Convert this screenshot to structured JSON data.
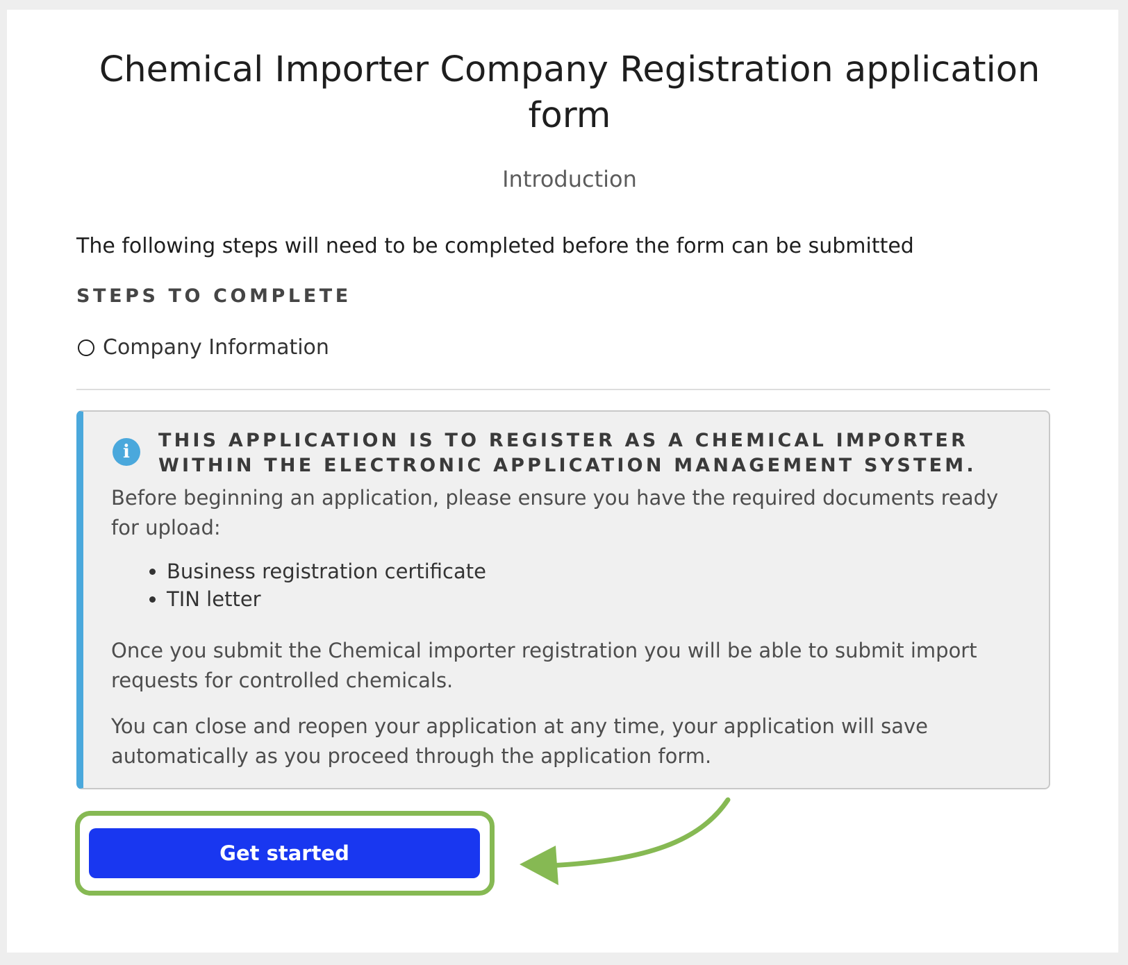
{
  "form": {
    "title": "Chemical Importer Company Registration application form",
    "subtitle": "Introduction",
    "lead": "The following steps will need to be completed before the form can be submitted",
    "steps_heading": "STEPS TO COMPLETE",
    "steps": [
      {
        "label": "Company Information",
        "status_icon": "empty-circle-icon"
      }
    ]
  },
  "notice": {
    "icon": "info-icon",
    "accent_color": "#4aa8dc",
    "heading": "THIS APPLICATION IS TO REGISTER AS A CHEMICAL IMPORTER WITHIN THE ELECTRONIC APPLICATION MANAGEMENT SYSTEM.",
    "intro": "Before beginning an application, please ensure you have the required documents ready for upload:",
    "documents": [
      "Business registration certificate",
      "TIN letter"
    ],
    "paragraph_2": "Once you submit the Chemical importer registration you will be able to submit import requests for controlled chemicals.",
    "paragraph_3": "You can close and reopen your application at any time, your application will save automatically as you proceed through the application form."
  },
  "actions": {
    "get_started_label": "Get started",
    "button_color": "#1937f0",
    "highlight_color": "#86b953"
  }
}
